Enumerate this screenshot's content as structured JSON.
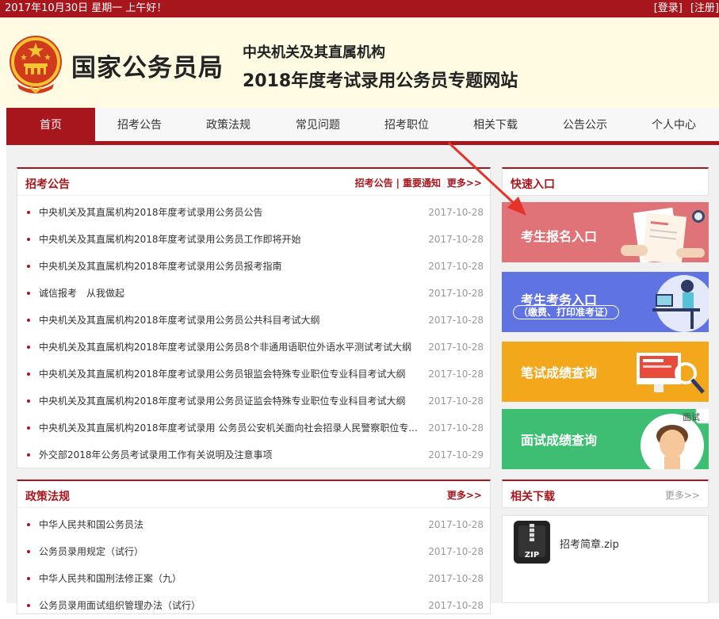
{
  "topbar": {
    "date_text": "2017年10月30日  星期一  上午好！",
    "login": "[登录]",
    "register": "[注册]"
  },
  "header": {
    "site_name": "国家公务员局",
    "subtitle_line1": "中央机关及其直属机构",
    "subtitle_line2": "2018年度考试录用公务员专题网站"
  },
  "nav": {
    "items": [
      {
        "label": "首页",
        "active": true
      },
      {
        "label": "招考公告"
      },
      {
        "label": "政策法规"
      },
      {
        "label": "常见问题"
      },
      {
        "label": "招考职位"
      },
      {
        "label": "相关下载"
      },
      {
        "label": "公告公示"
      },
      {
        "label": "个人中心"
      }
    ]
  },
  "announcements": {
    "title": "招考公告",
    "tab1": "招考公告",
    "tab2": "重要通知",
    "more": "更多>>",
    "items": [
      {
        "title": "中央机关及其直属机构2018年度考试录用公务员公告",
        "date": "2017-10-28"
      },
      {
        "title": "中央机关及其直属机构2018年度考试录用公务员工作即将开始",
        "date": "2017-10-28"
      },
      {
        "title": "中央机关及其直属机构2018年度考试录用公务员报考指南",
        "date": "2017-10-28"
      },
      {
        "title": "诚信报考　从我做起",
        "date": "2017-10-28"
      },
      {
        "title": "中央机关及其直属机构2018年度考试录用公务员公共科目考试大纲",
        "date": "2017-10-28"
      },
      {
        "title": "中央机关及其直属机构2018年度考试录用公务员8个非通用语职位外语水平测试考试大纲",
        "date": "2017-10-28"
      },
      {
        "title": "中央机关及其直属机构2018年度考试录用公务员银监会特殊专业职位专业科目考试大纲",
        "date": "2017-10-28"
      },
      {
        "title": "中央机关及其直属机构2018年度考试录用公务员证监会特殊专业职位专业科目考试大纲",
        "date": "2017-10-28"
      },
      {
        "title": "中央机关及其直属机构2018年度考试录用 公务员公安机关面向社会招录人民警察职位专...",
        "date": "2017-10-28"
      },
      {
        "title": "外交部2018年公务员考试录用工作有关说明及注意事项",
        "date": "2017-10-29"
      }
    ]
  },
  "policies": {
    "title": "政策法规",
    "more": "更多>>",
    "items": [
      {
        "title": "中华人民共和国公务员法",
        "date": "2017-10-28"
      },
      {
        "title": "公务员录用规定（试行）",
        "date": "2017-10-28"
      },
      {
        "title": "中华人民共和国刑法修正案（九）",
        "date": "2017-10-28"
      },
      {
        "title": "公务员录用面试组织管理办法（试行）",
        "date": "2017-10-28"
      }
    ]
  },
  "quick_entry": {
    "title": "快速入口",
    "tiles": [
      {
        "label": "考生报名入口",
        "color": "#e07378"
      },
      {
        "label": "考生考务入口",
        "sub": "（缴费、打印准考证）",
        "color": "#5f73e3"
      },
      {
        "label": "笔试成绩查询",
        "color": "#f3a71b"
      },
      {
        "label": "面试成绩查询",
        "badge": "面试",
        "color": "#3dbe72"
      }
    ]
  },
  "downloads": {
    "title": "相关下载",
    "more": "更多>>",
    "file_name": "招考简章.zip",
    "file_badge": "ZIP"
  },
  "colors": {
    "brand_red": "#a8161d",
    "header_bg": "#fffbe3"
  }
}
